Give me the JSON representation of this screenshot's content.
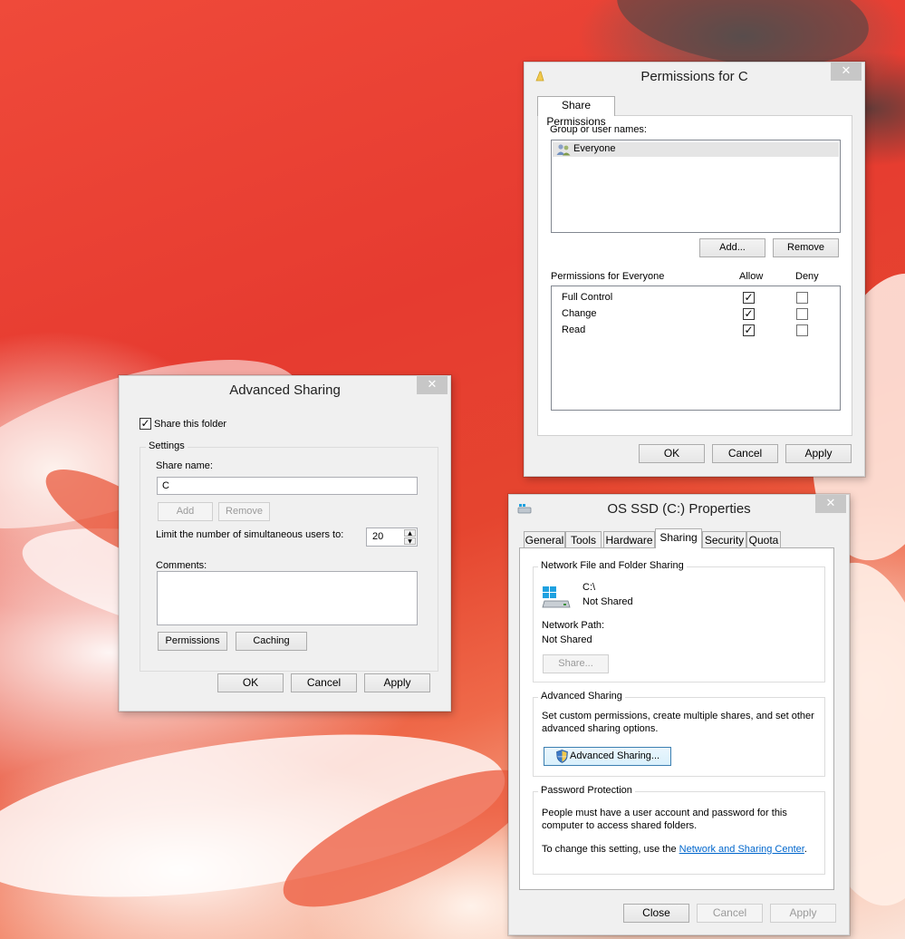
{
  "permissions_dialog": {
    "title": "Permissions for C",
    "close_glyph": "✕",
    "tab_label": "Share Permissions",
    "group_label": "Group or user names:",
    "users": [
      "Everyone"
    ],
    "add_label": "Add...",
    "remove_label": "Remove",
    "perm_header": "Permissions for Everyone",
    "allow_header": "Allow",
    "deny_header": "Deny",
    "permissions": [
      {
        "name": "Full Control",
        "allow": true,
        "deny": false
      },
      {
        "name": "Change",
        "allow": true,
        "deny": false
      },
      {
        "name": "Read",
        "allow": true,
        "deny": false
      }
    ],
    "ok_label": "OK",
    "cancel_label": "Cancel",
    "apply_label": "Apply"
  },
  "advanced_dialog": {
    "title": "Advanced Sharing",
    "close_glyph": "✕",
    "share_folder_label": "Share this folder",
    "share_folder_checked": true,
    "settings_label": "Settings",
    "share_name_label": "Share name:",
    "share_name_value": "C",
    "add_label": "Add",
    "remove_label": "Remove",
    "limit_label": "Limit the number of simultaneous users to:",
    "limit_value": "20",
    "comments_label": "Comments:",
    "comments_value": "",
    "permissions_label": "Permissions",
    "caching_label": "Caching",
    "ok_label": "OK",
    "cancel_label": "Cancel",
    "apply_label": "Apply"
  },
  "properties_dialog": {
    "title": "OS SSD (C:) Properties",
    "close_glyph": "✕",
    "tabs": [
      "General",
      "Tools",
      "Hardware",
      "Sharing",
      "Security",
      "Quota"
    ],
    "active_tab": "Sharing",
    "network_group_label": "Network File and Folder Sharing",
    "drive_path": "C:\\",
    "drive_status": "Not Shared",
    "network_path_label": "Network Path:",
    "network_path_value": "Not Shared",
    "share_button_label": "Share...",
    "advanced_group_label": "Advanced Sharing",
    "advanced_desc_line1": "Set custom permissions, create multiple shares, and set other",
    "advanced_desc_line2": "advanced sharing options.",
    "advanced_button_label": "Advanced Sharing...",
    "password_group_label": "Password Protection",
    "password_desc_line1": "People must have a user account and password for this",
    "password_desc_line2": "computer to access shared folders.",
    "change_setting_prefix": "To change this setting, use the ",
    "network_center_link": "Network and Sharing Center",
    "change_setting_suffix": ".",
    "close_label": "Close",
    "cancel_label": "Cancel",
    "apply_label": "Apply"
  },
  "colors": {
    "accent_link": "#0066cc",
    "dialog_bg": "#f0f0f0",
    "close_button_bg": "#c7c7c7"
  }
}
